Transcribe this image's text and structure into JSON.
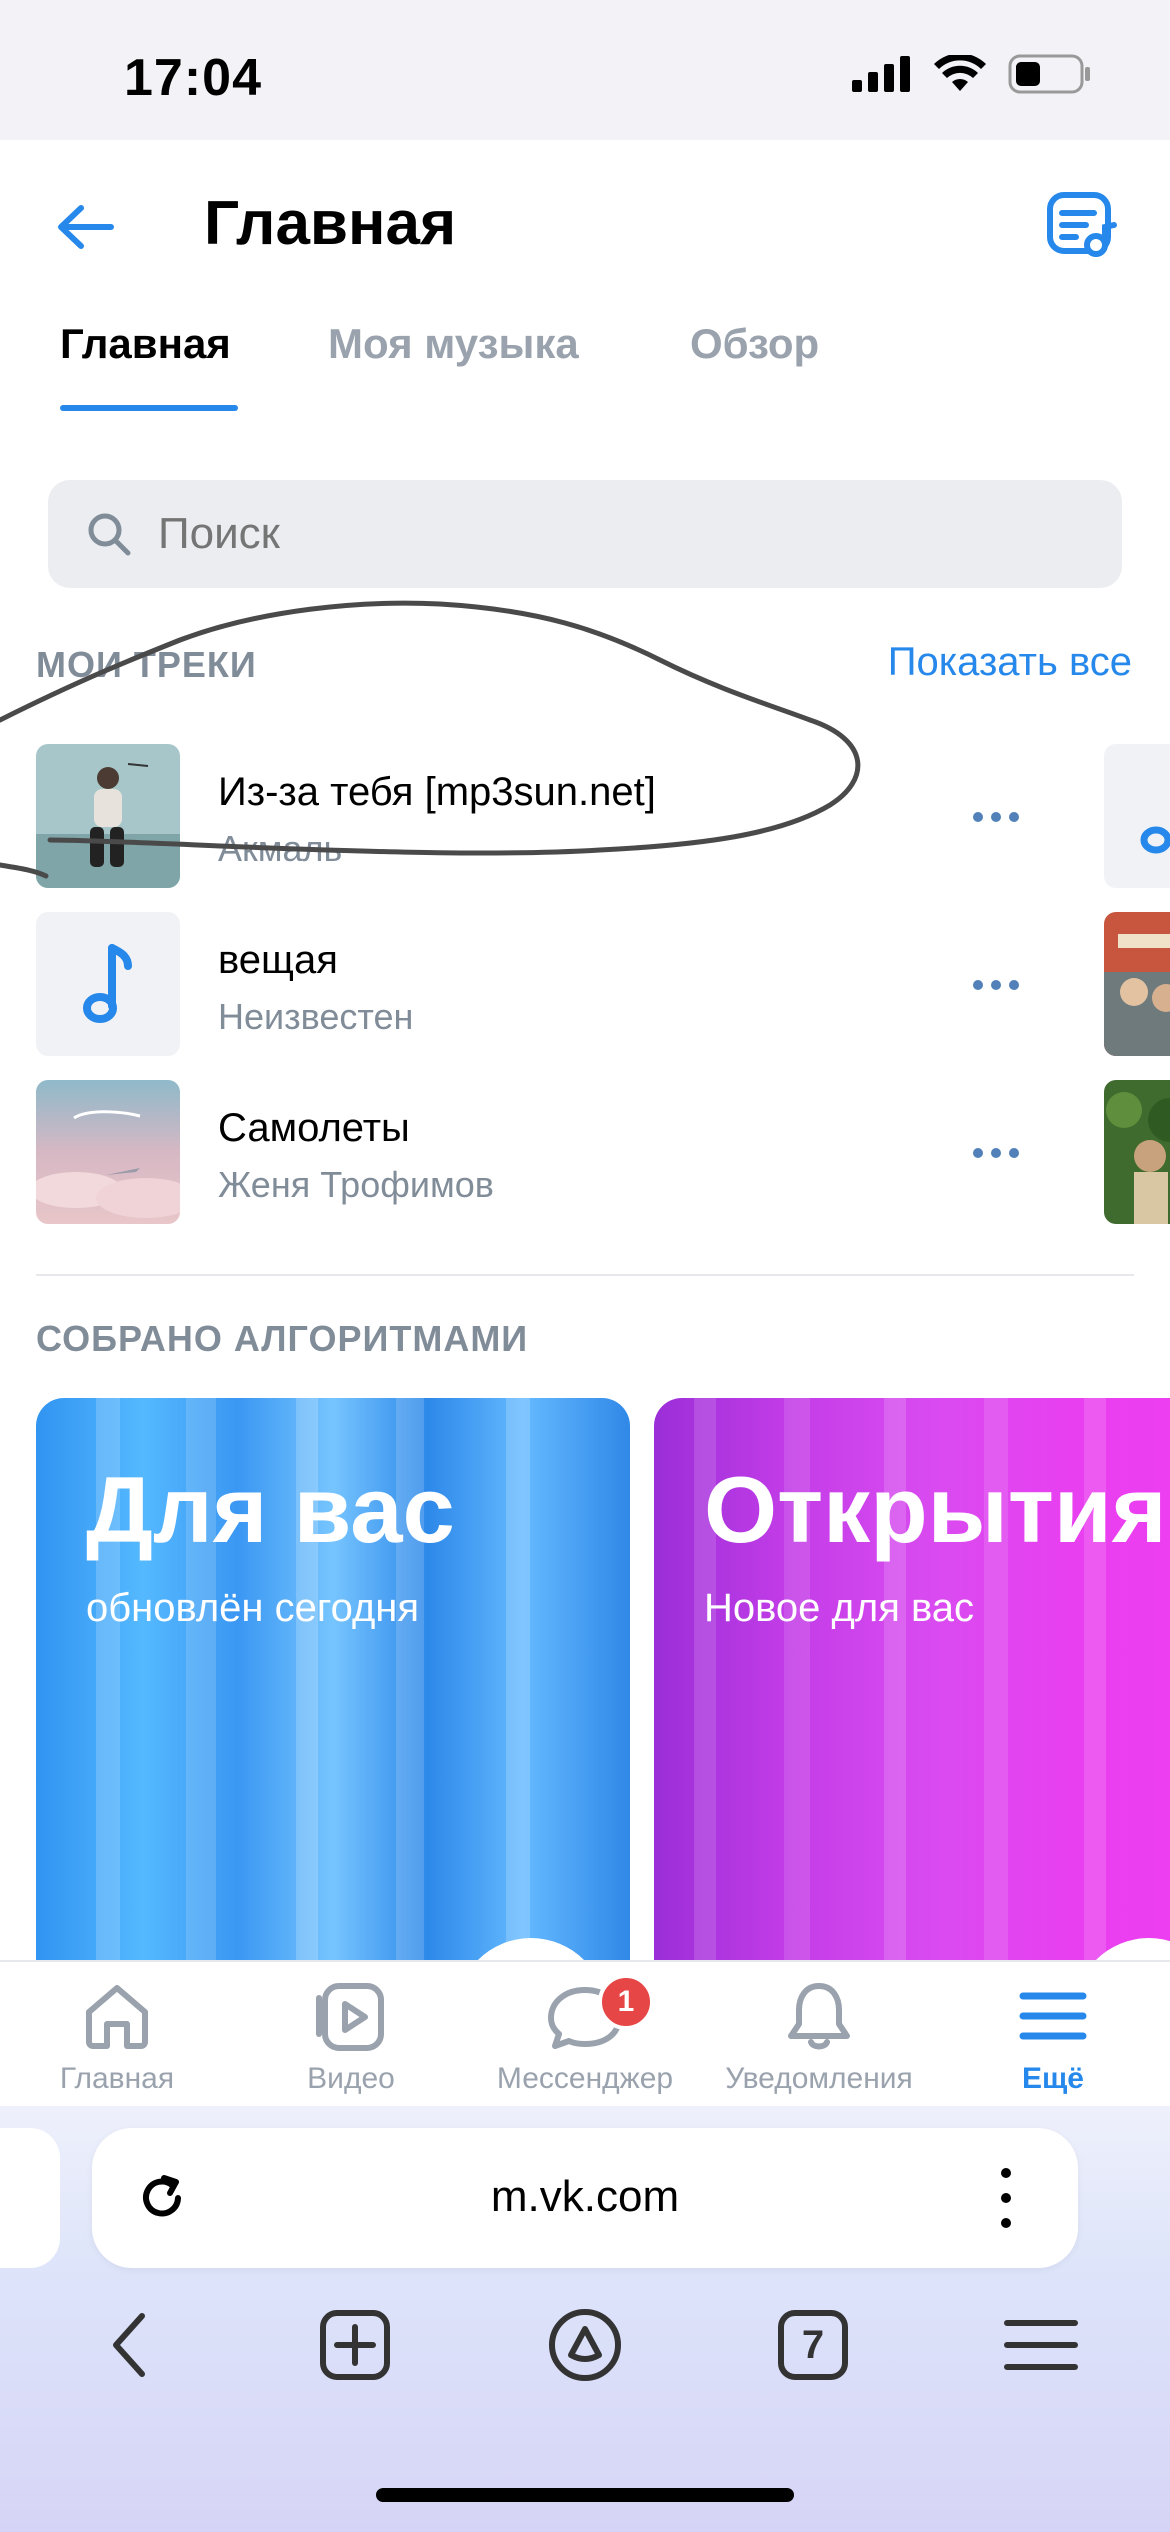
{
  "status_bar": {
    "time": "17:04"
  },
  "header": {
    "title": "Главная"
  },
  "tabs": [
    {
      "label": "Главная",
      "active": true
    },
    {
      "label": "Моя музыка",
      "active": false
    },
    {
      "label": "Обзор",
      "active": false
    }
  ],
  "search": {
    "placeholder": "Поиск"
  },
  "my_tracks": {
    "title": "МОИ ТРЕКИ",
    "show_all": "Показать все",
    "items": [
      {
        "title": "Из-за тебя [mp3sun.net]",
        "artist": "Акмаль"
      },
      {
        "title": "вещая",
        "artist": "Неизвестен"
      },
      {
        "title": "Самолеты",
        "artist": "Женя Трофимов"
      }
    ]
  },
  "algorithms": {
    "title": "СОБРАНО АЛГОРИТМАМИ",
    "cards": [
      {
        "title": "Для вас",
        "subtitle": "обновлён сегодня"
      },
      {
        "title": "Открытия",
        "subtitle": "Новое для вас"
      }
    ]
  },
  "bottom_nav": [
    {
      "label": "Главная",
      "icon": "home-icon"
    },
    {
      "label": "Видео",
      "icon": "video-icon"
    },
    {
      "label": "Мессенджер",
      "icon": "messenger-icon",
      "badge": "1"
    },
    {
      "label": "Уведомления",
      "icon": "bell-icon"
    },
    {
      "label": "Ещё",
      "icon": "menu-icon",
      "active": true
    }
  ],
  "browser": {
    "url": "m.vk.com",
    "tabs_count": "7"
  },
  "colors": {
    "accent": "#2688eb",
    "secondary_text": "#818c99",
    "badge": "#e64646"
  }
}
